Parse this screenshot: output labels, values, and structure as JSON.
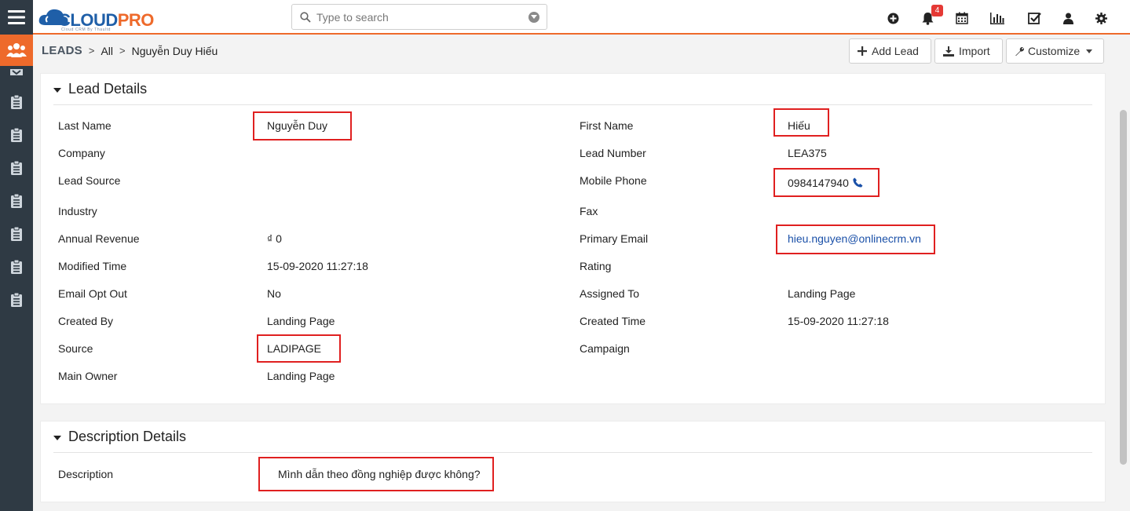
{
  "app": {
    "logo_part1": "CLOUD",
    "logo_part2": "PRO",
    "logo_tagline": "Cloud CRM By Thaultd",
    "brand_color": "#ee6a2b",
    "nav_color": "#2f3a44"
  },
  "search": {
    "placeholder": "Type to search"
  },
  "header_icons": [
    "add-circle-icon",
    "bell-icon",
    "calendar-icon",
    "report-chart-icon",
    "tasks-check-icon",
    "user-icon",
    "gear-icon"
  ],
  "notifications": {
    "count": "4"
  },
  "breadcrumb": {
    "module": "LEADS",
    "list": "All",
    "record": "Nguyễn Duy Hiếu"
  },
  "actions": {
    "add_lead": "Add Lead",
    "import": "Import",
    "customize": "Customize"
  },
  "lead_details": {
    "title": "Lead Details",
    "fields": {
      "last_name": {
        "label": "Last Name",
        "value": "Nguyễn Duy"
      },
      "first_name": {
        "label": "First Name",
        "value": "Hiếu"
      },
      "company": {
        "label": "Company",
        "value": ""
      },
      "lead_number": {
        "label": "Lead Number",
        "value": "LEA375"
      },
      "lead_source": {
        "label": "Lead Source",
        "value": ""
      },
      "mobile_phone": {
        "label": "Mobile Phone",
        "value": "0984147940"
      },
      "industry": {
        "label": "Industry",
        "value": ""
      },
      "fax": {
        "label": "Fax",
        "value": ""
      },
      "annual_revenue": {
        "label": "Annual Revenue",
        "value": "₫ 0"
      },
      "primary_email": {
        "label": "Primary Email",
        "value": "hieu.nguyen@onlinecrm.vn"
      },
      "modified_time": {
        "label": "Modified Time",
        "value": "15-09-2020 11:27:18"
      },
      "rating": {
        "label": "Rating",
        "value": ""
      },
      "email_opt_out": {
        "label": "Email Opt Out",
        "value": "No"
      },
      "assigned_to": {
        "label": "Assigned To",
        "value": "Landing Page"
      },
      "created_by": {
        "label": "Created By",
        "value": "Landing Page"
      },
      "created_time": {
        "label": "Created Time",
        "value": "15-09-2020 11:27:18"
      },
      "source": {
        "label": "Source",
        "value": "LADIPAGE"
      },
      "campaign": {
        "label": "Campaign",
        "value": ""
      },
      "main_owner": {
        "label": "Main Owner",
        "value": "Landing Page"
      }
    }
  },
  "description_details": {
    "title": "Description Details",
    "description": {
      "label": "Description",
      "value": "Mình dẫn theo đồng nghiệp được không?"
    }
  }
}
